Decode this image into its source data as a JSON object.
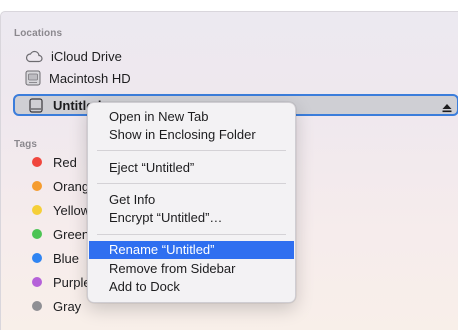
{
  "sidebar": {
    "locations_header": "Locations",
    "locations": [
      {
        "label": "iCloud Drive",
        "icon": "cloud-icon"
      },
      {
        "label": "Macintosh HD",
        "icon": "hard-drive-icon"
      },
      {
        "label": "Untitled",
        "icon": "external-drive-icon",
        "selected": true
      }
    ],
    "tags_header": "Tags",
    "tags": [
      {
        "label": "Red",
        "color": "#f0463d"
      },
      {
        "label": "Orange",
        "color": "#f59c2f"
      },
      {
        "label": "Yellow",
        "color": "#f5cf38"
      },
      {
        "label": "Green",
        "color": "#4cc454"
      },
      {
        "label": "Blue",
        "color": "#2f84f2"
      },
      {
        "label": "Purple",
        "color": "#b561d9"
      },
      {
        "label": "Gray",
        "color": "#8f8f94"
      }
    ]
  },
  "context_menu": {
    "items": {
      "open_new_tab": "Open in New Tab",
      "show_enclosing": "Show in Enclosing Folder",
      "eject": "Eject “Untitled”",
      "get_info": "Get Info",
      "encrypt": "Encrypt “Untitled”…",
      "rename": "Rename “Untitled”",
      "remove_sidebar": "Remove from Sidebar",
      "add_dock": "Add to Dock"
    },
    "highlight_color": "#2f6ff0"
  },
  "colors": {
    "selection_border": "#3b7ddb",
    "selection_fill": "#cfcfd4"
  }
}
